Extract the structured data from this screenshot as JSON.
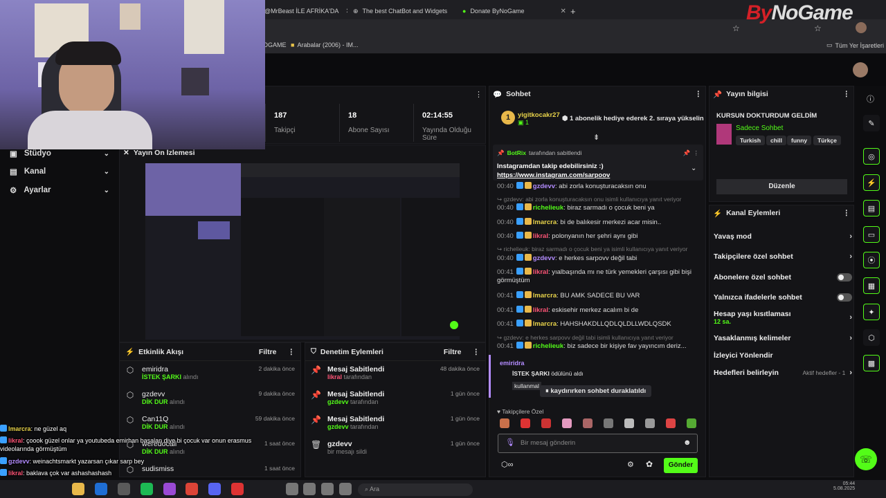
{
  "browser": {
    "tabs": [
      "@MrBeast İLE AFRİKA'DA",
      "The best ChatBot and Widgets",
      "Donate ByNoGame"
    ],
    "new_tab": "+",
    "bookmarks": [
      "OGAME",
      "Arabalar (2006) - IM..."
    ],
    "all_bookmarks": "Tüm Yer İşaretleri"
  },
  "brand": {
    "logo_a": "By",
    "logo_b": "NoGame"
  },
  "stats": [
    {
      "value": "187",
      "label": "Takipçi"
    },
    {
      "value": "18",
      "label": "Abone Sayısı"
    },
    {
      "value": "02:14:55",
      "label": "Yayında Olduğu Süre"
    }
  ],
  "sidebar": {
    "items": [
      {
        "label": "Stüdyo",
        "icon": "studio-icon"
      },
      {
        "label": "Kanal",
        "icon": "channel-icon"
      },
      {
        "label": "Ayarlar",
        "icon": "gear-icon"
      }
    ]
  },
  "preview": {
    "title": "Yayın Ön İzlemesi"
  },
  "activity": {
    "title": "Etkinlik Akışı",
    "filter": "Filtre",
    "rows": [
      {
        "name": "emiridra",
        "sub_bold": "İSTEK ŞARKI",
        "sub": "alındı",
        "time": "2 dakika önce"
      },
      {
        "name": "gzdevv",
        "sub_bold": "DİK DUR",
        "sub": "alındı",
        "time": "9 dakika önce"
      },
      {
        "name": "Can11Q",
        "sub_bold": "DİK DUR",
        "sub": "alındı",
        "time": "59 dakika önce"
      },
      {
        "name": "weredocall",
        "sub_bold": "DİK DUR",
        "sub": "alındı",
        "time": "1 saat önce"
      },
      {
        "name": "sudismiss",
        "sub_bold": "",
        "sub": "",
        "time": "1 saat önce"
      }
    ]
  },
  "moderation": {
    "title": "Denetim Eylemleri",
    "filter": "Filtre",
    "rows": [
      {
        "name": "Mesaj Sabitlendi",
        "who": "likral",
        "sub": "tarafından",
        "time": "48 dakika önce"
      },
      {
        "name": "Mesaj Sabitlendi",
        "who": "gzdevv",
        "sub": "tarafından",
        "time": "1 gün önce"
      },
      {
        "name": "Mesaj Sabitlendi",
        "who": "gzdevv",
        "sub": "tarafından",
        "time": "1 gün önce"
      },
      {
        "name": "gzdevv",
        "who": "",
        "sub": "bir mesajı sildi",
        "time": "1 gün önce"
      }
    ]
  },
  "chat": {
    "title": "Sohbet",
    "gift": {
      "user": "yigitkocakr27",
      "count": "1",
      "text": "1 abonelik hediye ederek 2. sıraya yükselin"
    },
    "pinned": {
      "by": "BotRix",
      "by_suffix": "tarafından sabitlendi",
      "text": "Instagramdan takip edebilirsiniz :)",
      "link": "https://www.instagram.com/sarpoov"
    },
    "lines": [
      {
        "time": "00:40",
        "user": "gzdevv",
        "ucls": "u-purple",
        "msg": "abi zorla konuşturacaksın onu"
      },
      {
        "reply": "gzdevv: abi zorla konuşturacaksın onu isimli kullanıcıya yanıt veriyor"
      },
      {
        "time": "00:40",
        "user": "richelieuk",
        "ucls": "u-green",
        "msg": "biraz sarmadı o çocuk beni ya"
      },
      {
        "time": "00:40",
        "user": "lmarcra",
        "ucls": "u-yellow",
        "msg": "bi de balıkesir merkezi acar misin.."
      },
      {
        "time": "00:40",
        "user": "likral",
        "ucls": "u-pink",
        "msg": "polonyanın her şehri aynı gibi"
      },
      {
        "reply": "richelieuk: biraz sarmadı o çocuk beni ya isimli kullanıcıya yanıt veriyor"
      },
      {
        "time": "00:40",
        "user": "gzdevv",
        "ucls": "u-purple",
        "msg": "e herkes sarpovv değil tabi"
      },
      {
        "time": "00:41",
        "user": "likral",
        "ucls": "u-pink",
        "msg": "yıalbaşında mı ne türk yemekleri çarşısı gibi bişi"
      },
      {
        "cont": "görmüştüm"
      },
      {
        "time": "00:41",
        "user": "lmarcra",
        "ucls": "u-yellow",
        "msg": "BU AMK SADECE BU VAR"
      },
      {
        "time": "00:41",
        "user": "likral",
        "ucls": "u-pink",
        "msg": "eskisehir merkez acalım bi de"
      },
      {
        "time": "00:41",
        "user": "lmarcra",
        "ucls": "u-yellow",
        "msg": "HAHSHAKDLLQDLQLDLLWDLQSDK"
      },
      {
        "reply": "gzdevv: e herkes sarpovv değil tabi isimli kullanıcıya yanıt veriyor"
      },
      {
        "time": "00:41",
        "user": "richelieuk",
        "ucls": "u-green",
        "msg": "biz sadece bir kişiye fav yayıncım deriz..."
      }
    ],
    "reward": {
      "user": "emiridra",
      "item": "İSTEK ŞARKI",
      "suffix": "ödülünü aldı",
      "note": "kullanmal"
    },
    "paused": "kaydırırken sohbet duraklatıldı",
    "followers_only": "Takipçilere Özel",
    "input_placeholder": "Bir mesaj gönderin",
    "send": "Gönder"
  },
  "stream_info": {
    "title": "Yayın bilgisi",
    "stream_title": "KURSUN DOKTURDUM GELDİM",
    "category": "Sadece Sohbet",
    "tags": [
      "Turkish",
      "chill",
      "funny",
      "Türkçe"
    ],
    "edit": "Düzenle"
  },
  "channel_actions": {
    "title": "Kanal Eylemleri",
    "items": [
      {
        "label": "Yavaş mod",
        "kind": "chev"
      },
      {
        "label": "Takipçilere özel sohbet",
        "kind": "chev"
      },
      {
        "label": "Abonelere özel sohbet",
        "kind": "toggle"
      },
      {
        "label": "Yalnızca ifadelerle sohbet",
        "kind": "toggle"
      },
      {
        "label": "Hesap yaşı kısıtlaması",
        "sub": "12 sa.",
        "kind": "chev"
      },
      {
        "label": "Yasaklanmış kelimeler",
        "kind": "chev"
      },
      {
        "label": "İzleyici Yönlendir",
        "kind": "none"
      },
      {
        "label": "Hedefleri belirleyin",
        "note": "Aktif hedefler - 1",
        "kind": "chev"
      }
    ]
  },
  "overlay_chat": [
    {
      "user": "lmarcra",
      "msg": ": ne güzel aq",
      "color": "#e8d34a"
    },
    {
      "user": "likral",
      "msg": ": çoook güzel onlar ya youtubeda emirhan başalan diye bi çocuk var onun erasmus",
      "color": "#ff5577"
    },
    {
      "user": "",
      "msg": "videolarında görmüştüm",
      "color": "#fff"
    },
    {
      "user": "gzdevv",
      "msg": ": weinachtsmarkt yazarsan çıkar sarp bey",
      "color": "#b38cff"
    },
    {
      "user": "likral",
      "msg": ": baklava çok var ashashashash",
      "color": "#ff5577"
    }
  ],
  "taskbar": {
    "search": "Ara",
    "time": "05:44",
    "date": "5.08.2025"
  },
  "colors": {
    "accent": "#53fc18",
    "brand_red": "#d42027"
  }
}
